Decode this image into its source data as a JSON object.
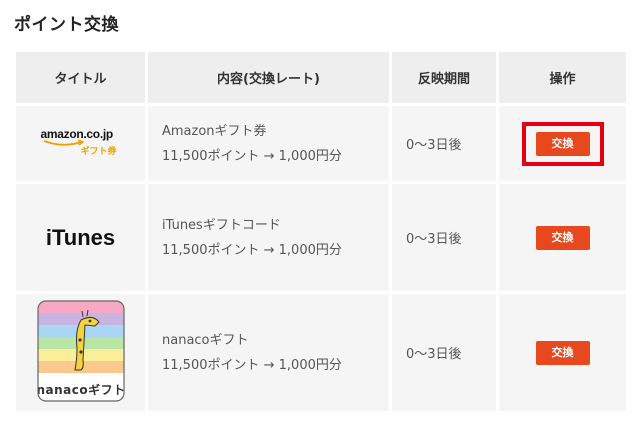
{
  "page": {
    "title": "ポイント交換"
  },
  "table": {
    "headers": {
      "title": "タイトル",
      "content": "内容(交換レート)",
      "days": "反映期間",
      "action": "操作"
    },
    "rows": [
      {
        "logo_icon": "amazon-logo",
        "logo_text": "amazon.co.jp",
        "logo_subtext": "ギフト券",
        "name": "Amazonギフト券",
        "rate": "11,500ポイント → 1,000円分",
        "days": "0～3日後",
        "button_label": "交換",
        "highlighted": true
      },
      {
        "logo_icon": "itunes-logo",
        "logo_text": "iTunes",
        "name": "iTunesギフトコード",
        "rate": "11,500ポイント → 1,000円分",
        "days": "0～3日後",
        "button_label": "交換",
        "highlighted": false
      },
      {
        "logo_icon": "nanaco-giraffe-logo",
        "logo_text": "nanacoギフト",
        "name": "nanacoギフト",
        "rate": "11,500ポイント → 1,000円分",
        "days": "0～3日後",
        "button_label": "交換",
        "highlighted": false
      }
    ]
  },
  "colors": {
    "accent": "#e8481e",
    "highlight": "#e60012",
    "amazon_gift": "#f0a000"
  }
}
